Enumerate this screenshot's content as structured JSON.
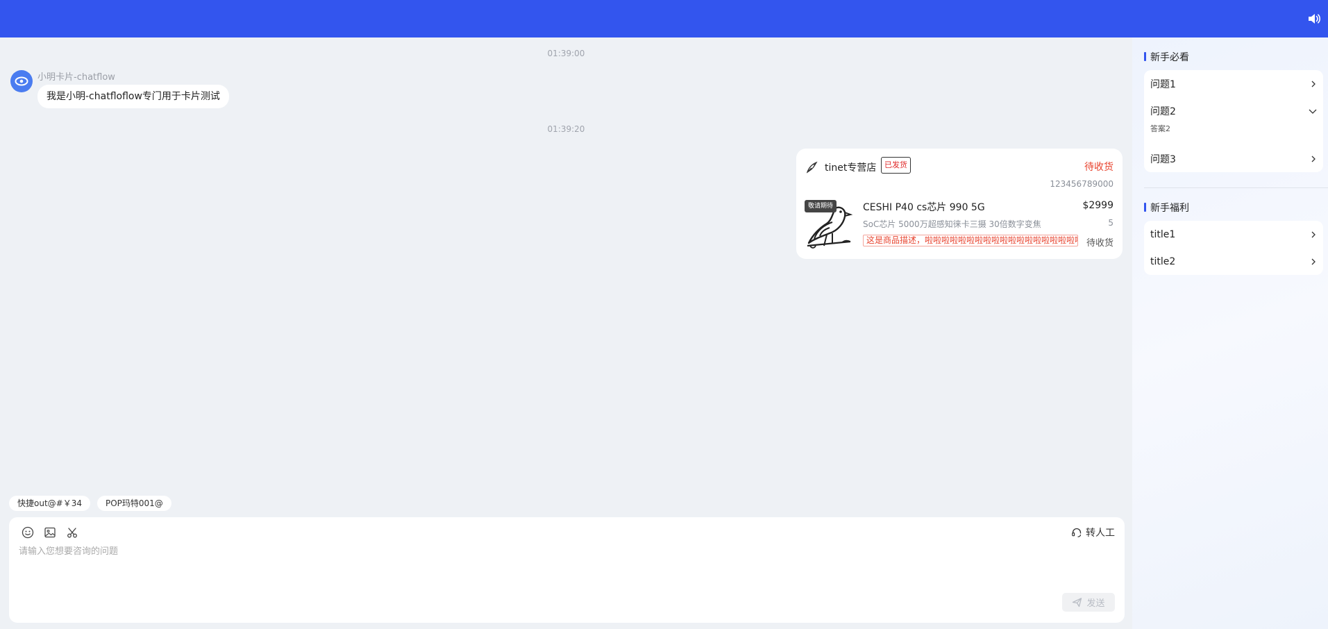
{
  "header": {
    "sound_icon": "speaker-icon",
    "color": "#3355ee"
  },
  "chat": {
    "timestamps": [
      "01:39:00",
      "01:39:20"
    ],
    "bot": {
      "name": "小明卡片-chatflow",
      "message": "我是小明-chatfloflow专门用于卡片测试",
      "avatar_icon": "eye-icon"
    },
    "order_card": {
      "shop_name": "tinet专营店",
      "ship_badge": "已发货",
      "status": "待收货",
      "order_no": "123456789000",
      "product": {
        "tag": "敬请期待",
        "name": "CESHI P40 cs芯片 990 5G",
        "price": "$2999",
        "spec": "SoC芯片 5000万超感知徕卡三摄 30倍数字变焦",
        "qty": "5",
        "description": "这是商品描述，啦啦啦啦啦啦啦啦啦啦啦啦啦啦啦啦啦啦啦啦啦啦",
        "status": "待收货"
      }
    }
  },
  "quick_replies": [
    "快捷out@#￥34",
    "POP玛特001@"
  ],
  "input": {
    "placeholder": "请输入您想要咨询的问题",
    "value": "",
    "transfer_label": "转人工",
    "send_label": "发送",
    "tools": [
      "emoji-icon",
      "image-icon",
      "scissors-icon"
    ]
  },
  "sidebar": {
    "section1": {
      "title": "新手必看",
      "items": [
        {
          "label": "问题1",
          "expanded": false
        },
        {
          "label": "问题2",
          "expanded": true,
          "answer": "答案2"
        },
        {
          "label": "问题3",
          "expanded": false
        }
      ]
    },
    "section2": {
      "title": "新手福利",
      "items": [
        {
          "label": "title1"
        },
        {
          "label": "title2"
        }
      ]
    }
  }
}
